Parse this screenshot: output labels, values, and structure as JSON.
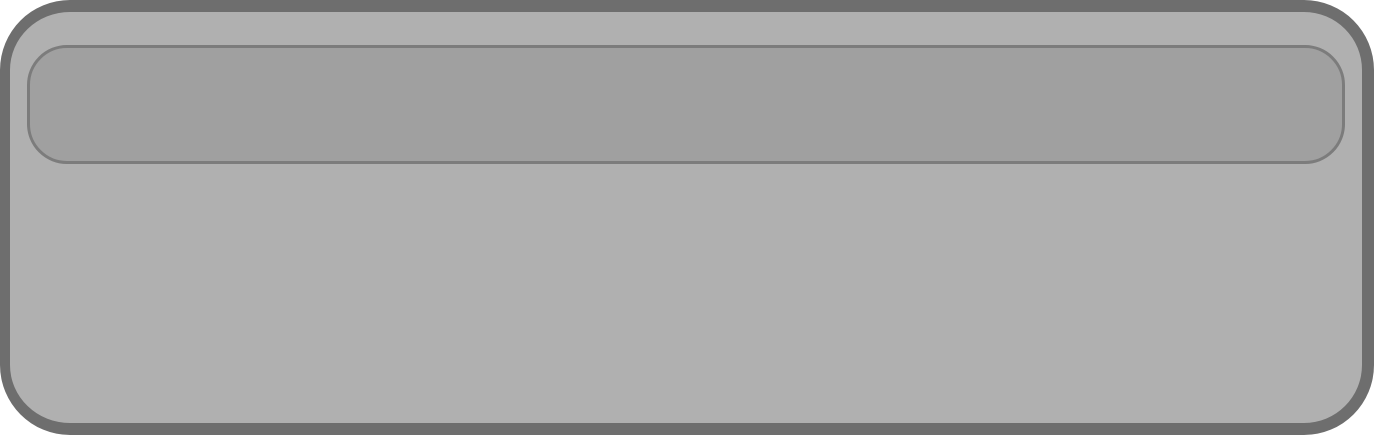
{
  "colors": {
    "panel_fill": "#b0b0b0",
    "panel_border": "#6e6e6e",
    "field_fill": "#a0a0a0",
    "field_border": "#7c7c7c"
  },
  "field": {
    "value": ""
  }
}
